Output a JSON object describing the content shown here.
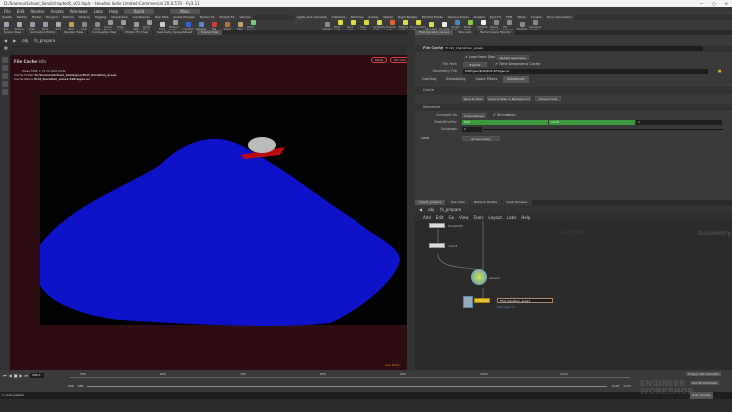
{
  "window": {
    "title": "D:/SnomonSchool_Sand/chapter8_v01.hiplc - Houdini Indie Limited-Commercial 20.0.570 - Py3.11",
    "controls": [
      "—",
      "◻",
      "✕"
    ]
  },
  "menu": {
    "items": [
      "File",
      "Edit",
      "Render",
      "Assets",
      "Windows",
      "Labs",
      "Help"
    ],
    "desktop": "Build",
    "desktop2": "Main"
  },
  "shelf_tabs_left": [
    "Create",
    "Modify",
    "Model",
    "Polygon",
    "Deform",
    "Texture",
    "Rigging",
    "Characters",
    "Constraints",
    "Hair Utils",
    "Guide Process",
    "Terrain FX",
    "Simple FX",
    "Volume"
  ],
  "shelf_tools_left": [
    {
      "label": "Box",
      "color": "#9aa3b5"
    },
    {
      "label": "Sphere",
      "color": "#aab"
    },
    {
      "label": "Tube",
      "color": "#99a"
    },
    {
      "label": "Torus",
      "color": "#99a"
    },
    {
      "label": "Grid",
      "color": "#aaa"
    },
    {
      "label": "Null",
      "color": "#c9a040"
    },
    {
      "label": "Line",
      "color": "#888"
    },
    {
      "label": "Circle",
      "color": "#888"
    },
    {
      "label": "Curve Bezier",
      "color": "#999"
    },
    {
      "label": "Draw Curve",
      "color": "#99a"
    },
    {
      "label": "Path",
      "color": "#999"
    },
    {
      "label": "Spray Paint",
      "color": "#999"
    },
    {
      "label": "Font",
      "color": "#ccc"
    },
    {
      "label": "Platonic Solids",
      "color": "#999"
    },
    {
      "label": "L-System",
      "color": "#36c"
    },
    {
      "label": "Metaball",
      "color": "#58c"
    },
    {
      "label": "File",
      "color": "#d04030"
    },
    {
      "label": "Spiral",
      "color": "#b07040"
    },
    {
      "label": "Helix",
      "color": "#c0a070"
    },
    {
      "label": "Quick Shapes",
      "color": "#7c7"
    }
  ],
  "shelf_tabs_right": [
    "Lights and Cameras",
    "Collisions",
    "Particles",
    "Grains",
    "Vellum",
    "Rigid Bodies",
    "Particle Fluids",
    "Viscous Fluids",
    "Oceans",
    "Pyro FX",
    "FEM",
    "Wires",
    "Crowds",
    "Drive Simulation"
  ],
  "shelf_tools_right": [
    {
      "label": "Camera",
      "color": "#888"
    },
    {
      "label": "Point Light",
      "color": "#dd4"
    },
    {
      "label": "Spot Light",
      "color": "#dd4"
    },
    {
      "label": "Area Light",
      "color": "#dd4"
    },
    {
      "label": "Geometry Light",
      "color": "#dd4"
    },
    {
      "label": "Volume Light",
      "color": "#d63"
    },
    {
      "label": "Distant Light",
      "color": "#dd4"
    },
    {
      "label": "Environment Light",
      "color": "#dd4"
    },
    {
      "label": "Sky Light",
      "color": "#dd4"
    },
    {
      "label": "GI Light",
      "color": "#eee"
    },
    {
      "label": "Caustic Light",
      "color": "#48c"
    },
    {
      "label": "Portal Light",
      "color": "#8c4"
    },
    {
      "label": "Ambient Light",
      "color": "#eee"
    },
    {
      "label": "Stereo Camera",
      "color": "#888"
    },
    {
      "label": "VR Camera",
      "color": "#888"
    },
    {
      "label": "Switcher",
      "color": "#888"
    },
    {
      "label": "Gamepad Camera",
      "color": "#888"
    }
  ],
  "left_panetabs": [
    "Scene View",
    "Animation Editor",
    "Render View",
    "Composite View",
    "Motion FX View",
    "Geometry Spreadsheet",
    "Scene View"
  ],
  "left_path": [
    "obj",
    "fs_prepare"
  ],
  "viewport": {
    "node_type": "File Cache",
    "node_suffix": "info",
    "hint": "Press Shift + F1 to hide hints",
    "cache_folder_label": "Cache Folder",
    "cache_folder": "D:/SnomonSchool_Sand/geo/first_iteration_areas",
    "cache_name_label": "Cache Name",
    "cache_name": "first_iteration_area1.590.bgeo.sc",
    "persp": "Persp",
    "cam": "No cam",
    "indie": "Indie Edition"
  },
  "right_panetabs": [
    "first_iteration_area1",
    "Take List",
    "Performance Monitor"
  ],
  "right_path": [
    "obj",
    "fs_prepare"
  ],
  "params": {
    "node_type": "File Cache",
    "node_name": "first_iteration_area1",
    "load_from_disk": "Load from Disk",
    "reload": "Reload Geometry",
    "file_path_label": "File Path",
    "file_path": "Explicit",
    "time_dep": "Time Dependent Cache",
    "geo_file_label": "Geometry File",
    "geo_file": "$HIP/geo/$OS/$OS.$F.bgeo.sc",
    "tabs": [
      "Caching",
      "Scheduling",
      "Spare Filters",
      "Advanced"
    ],
    "cache_section": "Cache",
    "save": "Save to Disk",
    "save_bg": "Save to Disk in Background",
    "cancel": "Cancel Cook",
    "sequence_section": "Sequence",
    "evaluate_label": "Evaluate As",
    "evaluate": "Frame Range",
    "simulation": "Simulation",
    "range_label": "Start/End/Inc",
    "start": "600",
    "end": "1128",
    "inc": "1",
    "substeps_label": "Substeps",
    "substeps": "1",
    "load_section": "Load",
    "load": "All Geometry"
  },
  "net_panetabs": [
    "/obj/fs_prepare",
    "Tree View",
    "Material Palette",
    "Asset Browser"
  ],
  "net_path": [
    "obj",
    "fs_prepare"
  ],
  "net_menu": [
    "Add",
    "Edit",
    "Go",
    "View",
    "Tools",
    "Layout",
    "Labs",
    "Help"
  ],
  "net": {
    "watermark": "Indie Edition",
    "context": "Geometry",
    "nodes": [
      {
        "name": "timeshift1"
      },
      {
        "name": "color3"
      },
      {
        "name": "solver1"
      },
      {
        "name": "first_iteration_area1"
      }
    ],
    "editing": "first_iteration_area1",
    "sub": "590.bgeo.sc"
  },
  "timeline": {
    "frame": "590.1",
    "ticks": [
      "500",
      "600",
      "700",
      "800",
      "900",
      "1000",
      "1100"
    ],
    "start": "568",
    "start2": "568",
    "end": "1128",
    "end2": "1128",
    "keys": "0 keys, 0/0 channels",
    "key_all": "Key All Channels",
    "auto": "Auto Update"
  },
  "status": {
    "text": "1 node pasted"
  },
  "logo": "ENGINEER WORKSHOP"
}
